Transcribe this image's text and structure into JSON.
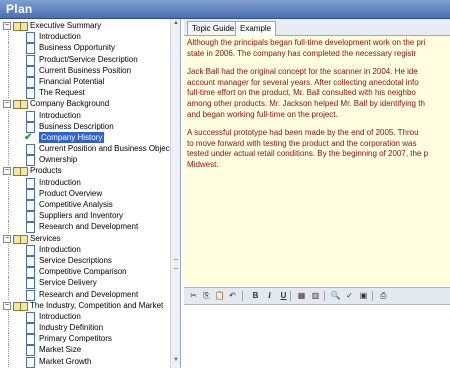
{
  "window": {
    "title": "Plan"
  },
  "tree": [
    {
      "type": "folder",
      "label": "Executive Summary",
      "expanded": true
    },
    {
      "type": "leaf",
      "label": "Introduction"
    },
    {
      "type": "leaf",
      "label": "Business Opportunity"
    },
    {
      "type": "leaf",
      "label": "Product/Service Description"
    },
    {
      "type": "leaf",
      "label": "Current Business Position"
    },
    {
      "type": "leaf",
      "label": "Financial Potential"
    },
    {
      "type": "leaf",
      "label": "The Request"
    },
    {
      "type": "folder",
      "label": "Company Background",
      "expanded": true
    },
    {
      "type": "leaf",
      "label": "Introduction"
    },
    {
      "type": "leaf",
      "label": "Business Description"
    },
    {
      "type": "leaf",
      "label": "Company History",
      "selected": true,
      "checked": true
    },
    {
      "type": "leaf",
      "label": "Current Position and Business Objectives"
    },
    {
      "type": "leaf",
      "label": "Ownership"
    },
    {
      "type": "folder",
      "label": "Products",
      "expanded": true
    },
    {
      "type": "leaf",
      "label": "Introduction"
    },
    {
      "type": "leaf",
      "label": "Product Overview"
    },
    {
      "type": "leaf",
      "label": "Competitive Analysis"
    },
    {
      "type": "leaf",
      "label": "Suppliers and Inventory"
    },
    {
      "type": "leaf",
      "label": "Research and Development"
    },
    {
      "type": "folder",
      "label": "Services",
      "expanded": true
    },
    {
      "type": "leaf",
      "label": "Introduction"
    },
    {
      "type": "leaf",
      "label": "Service Descriptions"
    },
    {
      "type": "leaf",
      "label": "Competitive Comparison"
    },
    {
      "type": "leaf",
      "label": "Service Delivery"
    },
    {
      "type": "leaf",
      "label": "Research and Development"
    },
    {
      "type": "folder",
      "label": "The Industry, Competition and Market",
      "expanded": true
    },
    {
      "type": "leaf",
      "label": "Introduction"
    },
    {
      "type": "leaf",
      "label": "Industry Definition"
    },
    {
      "type": "leaf",
      "label": "Primary Competitors"
    },
    {
      "type": "leaf",
      "label": "Market Size"
    },
    {
      "type": "leaf",
      "label": "Market Growth"
    }
  ],
  "tabs": [
    {
      "label": "Topic Guide",
      "active": false
    },
    {
      "label": "Example",
      "active": true
    }
  ],
  "content": {
    "paragraphs": [
      [
        "Although the principals began full-time development work on the pri",
        "state in 2006. The company has completed the necessary registr"
      ],
      [
        "Jack Ball had the original concept for the scanner in 2004. He ide",
        "account manager for several years. After collecting anecdotal info",
        "full-time effort on the product, Mr. Ball consulted with his neighbo",
        "among other products. Mr. Jackson helped Mr. Ball by identifying th",
        "and began working full-time on the project."
      ],
      [
        "A successful prototype had been made by the end of 2005. Throu",
        "to move forward with testing the product and the corporation was",
        "tested under actual retail conditions. By the beginning of 2007, the p",
        "Midwest."
      ]
    ]
  },
  "toolbar": {
    "buttons": [
      {
        "name": "cut-icon",
        "glyph": "✂"
      },
      {
        "name": "copy-icon",
        "glyph": "⎘"
      },
      {
        "name": "paste-icon",
        "glyph": "📋"
      },
      {
        "name": "undo-icon",
        "glyph": "↶"
      },
      {
        "name": "bold-button",
        "glyph": "B",
        "cls": "b"
      },
      {
        "name": "italic-button",
        "glyph": "I",
        "cls": "i"
      },
      {
        "name": "underline-button",
        "glyph": "U",
        "cls": "u"
      },
      {
        "name": "table-icon",
        "glyph": "▦"
      },
      {
        "name": "chart-icon",
        "glyph": "▥"
      },
      {
        "name": "find-icon",
        "glyph": "🔍"
      },
      {
        "name": "spellcheck-icon",
        "glyph": "✓"
      },
      {
        "name": "image-icon",
        "glyph": "▣"
      },
      {
        "name": "print-icon",
        "glyph": "⎙"
      }
    ]
  }
}
